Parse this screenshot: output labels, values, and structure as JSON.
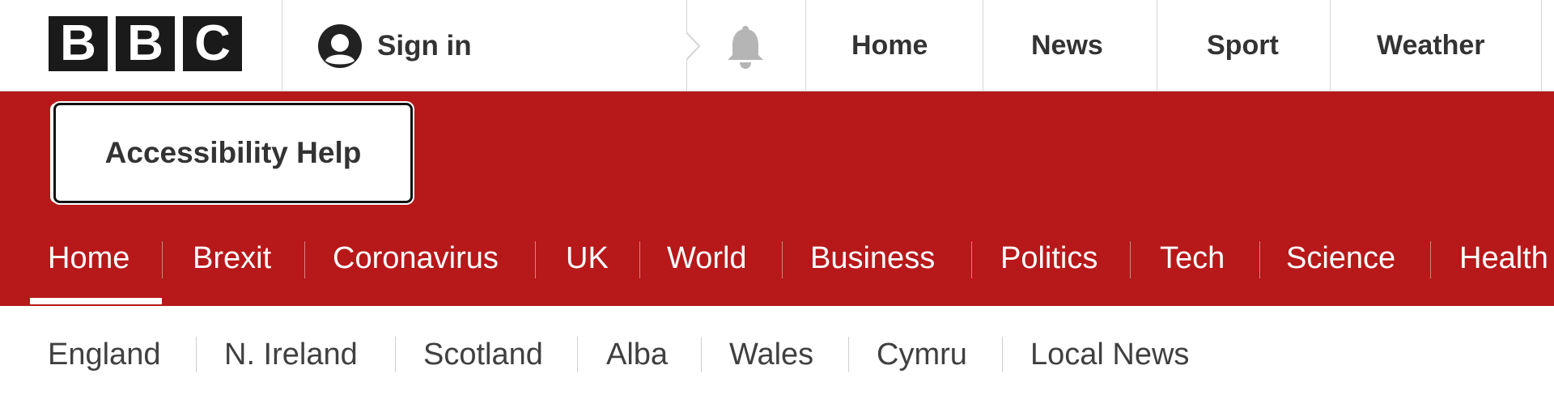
{
  "logo": {
    "letters": [
      "B",
      "B",
      "C"
    ]
  },
  "account": {
    "signin_label": "Sign in",
    "icon": "user-avatar-icon"
  },
  "notifications": {
    "icon": "bell-icon"
  },
  "top_links": [
    "Home",
    "News",
    "Sport",
    "Weather"
  ],
  "accessibility": {
    "label": "Accessibility Help"
  },
  "primary_nav": {
    "active_index": 0,
    "items": [
      "Home",
      "Brexit",
      "Coronavirus",
      "UK",
      "World",
      "Business",
      "Politics",
      "Tech",
      "Science",
      "Health"
    ]
  },
  "region_nav": {
    "items": [
      "England",
      "N. Ireland",
      "Scotland",
      "Alba",
      "Wales",
      "Cymru",
      "Local News"
    ]
  },
  "colors": {
    "brand_red": "#b7181a",
    "logo_black": "#1a1a1a",
    "text_dark": "#333333",
    "bell_grey": "#b5b5b5"
  }
}
